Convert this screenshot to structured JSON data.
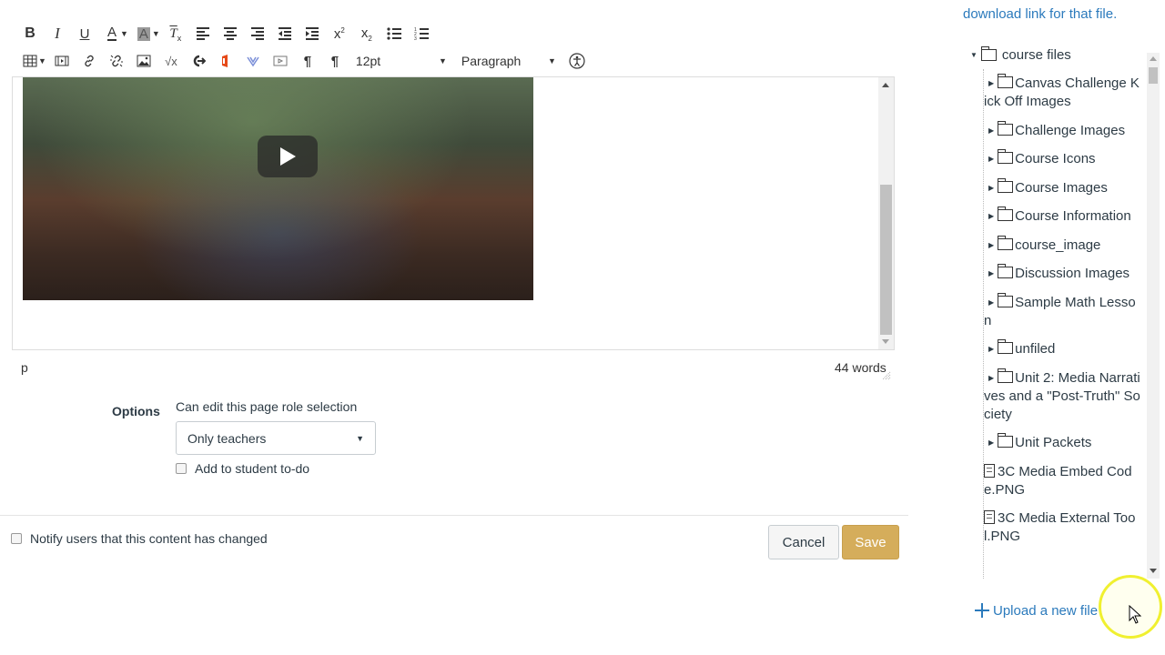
{
  "toolbar": {
    "row1": [
      {
        "name": "bold-button",
        "icon": "bold-icon",
        "glyph": "B"
      },
      {
        "name": "italic-button",
        "icon": "italic-icon",
        "glyph": "I"
      },
      {
        "name": "underline-button",
        "icon": "underline-icon",
        "glyph": "U"
      },
      {
        "name": "text-color-button",
        "icon": "text-color-icon",
        "glyph": "A"
      },
      {
        "name": "background-color-button",
        "icon": "background-color-icon",
        "glyph": "A"
      },
      {
        "name": "clear-formatting-button",
        "icon": "clear-formatting-icon",
        "glyph": "Tx"
      },
      {
        "name": "align-left-button",
        "icon": "align-left-icon"
      },
      {
        "name": "align-center-button",
        "icon": "align-center-icon"
      },
      {
        "name": "align-right-button",
        "icon": "align-right-icon"
      },
      {
        "name": "outdent-button",
        "icon": "outdent-icon"
      },
      {
        "name": "indent-button",
        "icon": "indent-icon"
      },
      {
        "name": "superscript-button",
        "icon": "superscript-icon",
        "glyph": "x²"
      },
      {
        "name": "subscript-button",
        "icon": "subscript-icon",
        "glyph": "x₂"
      },
      {
        "name": "bullet-list-button",
        "icon": "bullet-list-icon"
      },
      {
        "name": "numbered-list-button",
        "icon": "numbered-list-icon"
      }
    ],
    "font_size": "12pt",
    "block_format": "Paragraph"
  },
  "editor": {
    "status_path": "p",
    "word_count": "44 words"
  },
  "options": {
    "label": "Options",
    "role_label": "Can edit this page role selection",
    "role_value": "Only teachers",
    "todo_label": "Add to student to-do"
  },
  "footer": {
    "notify_label": "Notify users that this content has changed",
    "cancel_label": "Cancel",
    "save_label": "Save"
  },
  "sidebar": {
    "intro_text": "download link for that file.",
    "root": "course files",
    "items": [
      {
        "type": "folder",
        "label": "Canvas Challenge Kick Off Images"
      },
      {
        "type": "folder",
        "label": "Challenge Images"
      },
      {
        "type": "folder",
        "label": "Course Icons"
      },
      {
        "type": "folder",
        "label": "Course Images"
      },
      {
        "type": "folder",
        "label": "Course Information"
      },
      {
        "type": "folder",
        "label": "course_image"
      },
      {
        "type": "folder",
        "label": "Discussion Images"
      },
      {
        "type": "folder",
        "label": "Sample Math Lesson"
      },
      {
        "type": "folder",
        "label": "unfiled"
      },
      {
        "type": "folder",
        "label": "Unit 2: Media Narratives and a \"Post-Truth\" Society"
      },
      {
        "type": "folder",
        "label": "Unit Packets"
      },
      {
        "type": "file",
        "label": "3C Media Embed Code.PNG"
      },
      {
        "type": "file",
        "label": "3C Media External Tool.PNG"
      }
    ],
    "upload_label": "Upload a new file"
  },
  "colors": {
    "link": "#2b7abc",
    "save": "#d5ad5b"
  }
}
